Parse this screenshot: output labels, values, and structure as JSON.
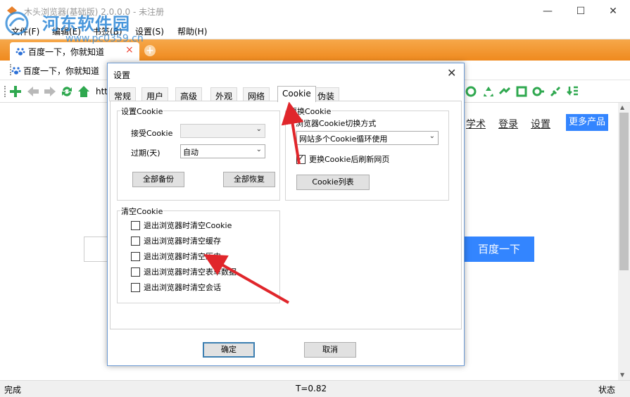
{
  "window": {
    "title": "木头浏览器(基础版) 2.0.0.0 - 未注册",
    "minimize_glyph": "—",
    "maximize_glyph": "☐",
    "close_glyph": "✕"
  },
  "watermark": {
    "text": "河东软件园",
    "url": "www.pc0359.cn"
  },
  "menu": [
    "文件(F)",
    "编辑(E)",
    "书签(B)",
    "设置(S)",
    "帮助(H)"
  ],
  "tab": {
    "label": "百度一下，你就知道",
    "close": "×",
    "new": "+"
  },
  "favorites": {
    "label": "百度一下，你就知道"
  },
  "toolbar": {
    "address_prefix": "htt"
  },
  "page": {
    "links": [
      "学术",
      "登录",
      "设置"
    ],
    "more_products": "更多产品",
    "search_button": "百度一下"
  },
  "status": {
    "left": "完成",
    "center": "T=0.82",
    "right": "状态"
  },
  "dialog": {
    "title": "设置",
    "close": "✕",
    "tabs": [
      "常规",
      "用户",
      "高级",
      "外观",
      "网络",
      "Cookie",
      "伪装"
    ],
    "active_tab": "Cookie",
    "set_cookie": {
      "title": "设置Cookie",
      "accept_label": "接受Cookie",
      "accept_value": "",
      "expire_label": "过期(天)",
      "expire_value": "自动",
      "backup_button": "全部备份",
      "restore_button": "全部恢复"
    },
    "switch_cookie": {
      "title": "更换Cookie",
      "mode_label": "浏览器Cookie切换方式",
      "mode_value": "网站多个Cookie循环使用",
      "refresh_label": "更换Cookie后刷新网页",
      "refresh_checked": true,
      "list_button": "Cookie列表"
    },
    "clear_cookie": {
      "title": "清空Cookie",
      "options": [
        {
          "label": "退出浏览器时清空Cookie",
          "checked": false
        },
        {
          "label": "退出浏览器时清空缓存",
          "checked": false
        },
        {
          "label": "退出浏览器时清空历史",
          "checked": false
        },
        {
          "label": "退出浏览器时清空表单数据",
          "checked": false
        },
        {
          "label": "退出浏览器时清空会话",
          "checked": false
        }
      ]
    },
    "ok_button": "确定",
    "cancel_button": "取消"
  },
  "colors": {
    "tabbar": "#f39a2e",
    "accent_blue": "#3385ff",
    "arrow": "#e0262b"
  }
}
